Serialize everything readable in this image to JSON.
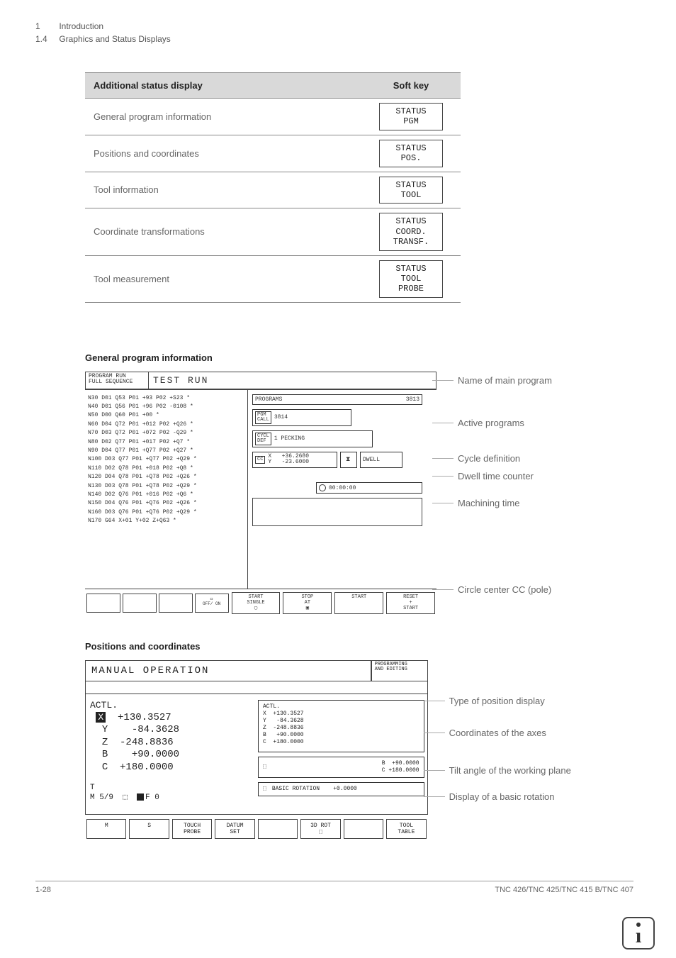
{
  "header": {
    "chapter_num": "1",
    "chapter_title": "Introduction",
    "section_num": "1.4",
    "section_title": "Graphics and Status Displays"
  },
  "table": {
    "col1": "Additional status display",
    "col2": "Soft key",
    "rows": [
      {
        "label": "General program information",
        "softkey": "STATUS\nPGM"
      },
      {
        "label": "Positions and coordinates",
        "softkey": "STATUS\nPOS."
      },
      {
        "label": "Tool information",
        "softkey": "STATUS\nTOOL"
      },
      {
        "label": "Coordinate transformations",
        "softkey": "STATUS\nCOORD.\nTRANSF."
      },
      {
        "label": "Tool measurement",
        "softkey": "STATUS\nTOOL\nPROBE"
      }
    ]
  },
  "section1": {
    "title": "General program information",
    "mode1": "PROGRAM RUN\nFULL SEQUENCE",
    "mode2": "TEST RUN",
    "code_lines": [
      "N30 D01 Q53 P01 +93 P02 +S23 *",
      "N40 D01 Q56 P01 +96 P02 -0108 *",
      "N50 D00 Q60 P01 +00 *",
      "N60 D04 Q72 P01 +012 P02 +Q26 *",
      "N70 D03 Q72 P01 +072 P02 -Q29 *",
      "N80 D02 Q77 P01 +017 P02 +Q7 *",
      "N90 D04 Q77 P01 +Q77 P02 +Q27 *",
      "N100 D03 Q77 P01 +Q77 P02 +Q29 *",
      "N110 D02 Q78 P01 +018 P02 +Q8 *",
      "N120 D04 Q78 P01 +Q78 P02 +Q26 *",
      "N130 D03 Q78 P01 +Q78 P02 +Q29 *",
      "N140 D02 Q76 P01 +016 P02 +Q6 *",
      "N150 D04 Q76 P01 +Q76 P02 +Q26 *",
      "N160 D03 Q76 P01 +Q76 P02 +Q29 *",
      "N170 G64 X+01 Y+02 Z+Q63 *"
    ],
    "programs_label": "PROGRAMS",
    "programs_num": "3813",
    "pgm_call": "PGM\nCALL",
    "pgm_call_val": "3814",
    "cycl_def": "CYCL\nDEF",
    "cycl_val": "1  PECKING",
    "cc_lbl": "CC",
    "cc_x": "X   +36.2680",
    "cc_y": "Y   -23.6000",
    "dwell": "DWELL",
    "time": "00:00:00",
    "off_on": "OFF/ ON",
    "sq_sym": "◻",
    "bottom_softkeys": [
      "START\nSINGLE\n▢",
      "STOP\nAT\n▣",
      "START",
      "RESET\n+\nSTART"
    ],
    "callouts": [
      "Name of main program",
      "Active programs",
      "Cycle definition",
      "Dwell time counter",
      "Machining time",
      "Circle center CC (pole)"
    ]
  },
  "section2": {
    "title": "Positions and coordinates",
    "manual": "MANUAL OPERATION",
    "prgedit": "PROGRAMMING\nAND EDITING",
    "actl": "ACTL.",
    "coords_left": {
      "X_lbl": "X",
      "X": "+130.3527",
      "Y_lbl": "Y",
      "Y": " -84.3628",
      "Z_lbl": "Z",
      "Z": "-248.8836",
      "B_lbl": "B",
      "B": " +90.0000",
      "C_lbl": "C",
      "C": "+180.0000"
    },
    "status_left": {
      "T": "T",
      "M": "M 5/9",
      "F": "F 0"
    },
    "box_actl": "ACTL.\nX  +130.3527\nY   -84.3628\nZ  -248.8836\nB   +90.0000\nC  +180.0000",
    "box_tilt": "B  +90.0000\nC +180.0000",
    "box_basic": "BASIC ROTATION    +0.0000",
    "bottom_softkeys": [
      "M",
      "S",
      "TOUCH\nPROBE",
      "DATUM\nSET",
      "",
      "3D ROT\n⬚",
      "",
      "TOOL\nTABLE"
    ],
    "callouts": [
      "Type of position display",
      "Coordinates of the axes",
      "Tilt angle of the working plane",
      "Display of a basic rotation"
    ]
  },
  "footer": {
    "page": "1-28",
    "doc": "TNC 426/TNC 425/TNC 415 B/TNC 407"
  }
}
